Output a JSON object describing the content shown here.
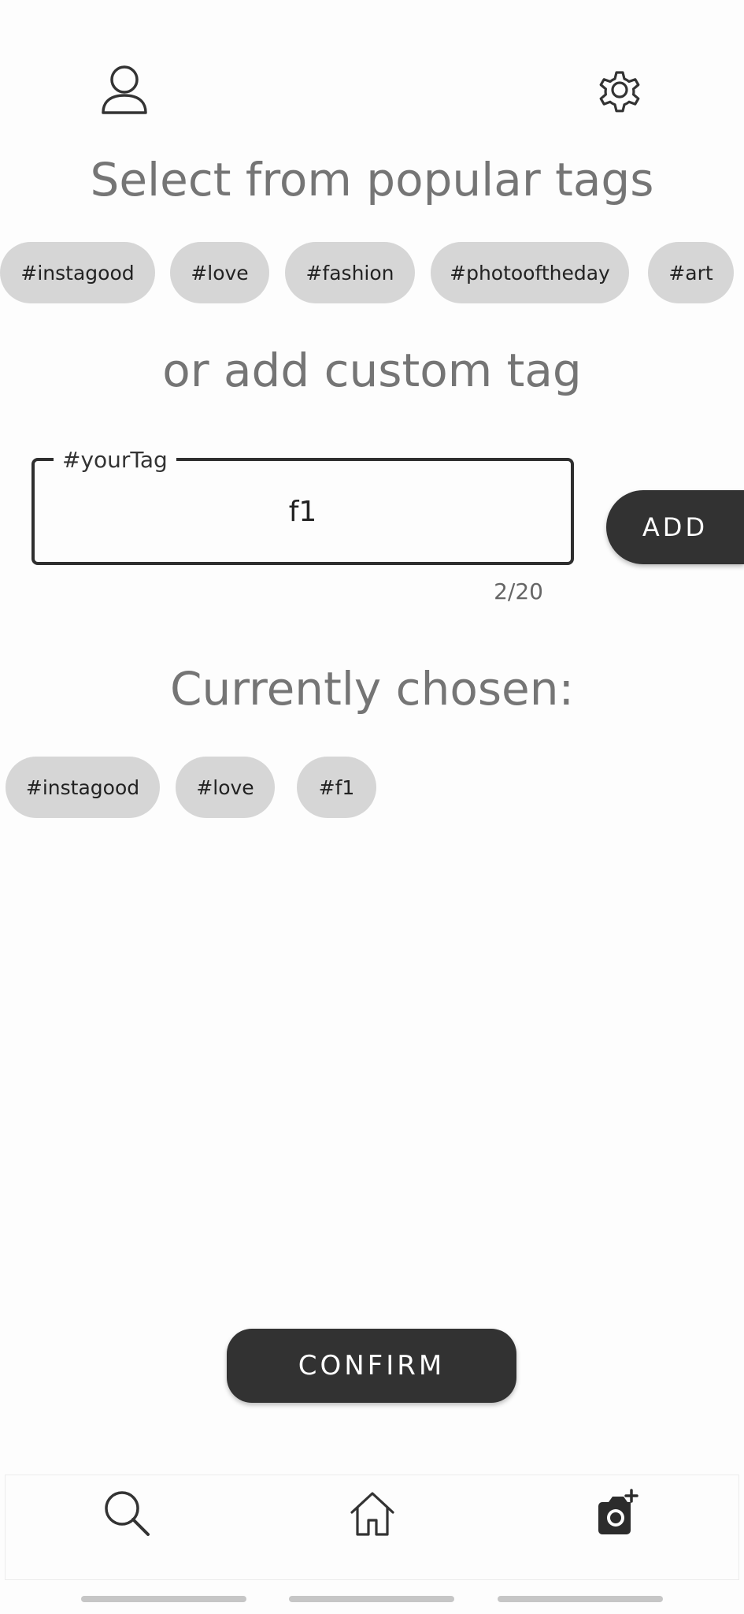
{
  "header": {
    "profile_icon": "person-icon",
    "settings_icon": "gear-icon"
  },
  "popular": {
    "title": "Select from popular tags",
    "tags": [
      "#instagood",
      "#love",
      "#fashion",
      "#photooftheday",
      "#art"
    ]
  },
  "custom": {
    "title": "or add custom tag",
    "field_label": "#yourTag",
    "field_value": "f1",
    "counter": "2/20",
    "add_label": "ADD"
  },
  "chosen": {
    "title": "Currently chosen:",
    "tags": [
      "#instagood",
      "#love",
      "#f1"
    ]
  },
  "confirm_label": "CONFIRM",
  "bottom_nav": {
    "items": [
      "search-icon",
      "home-icon",
      "add-photo-camera-icon"
    ]
  },
  "colors": {
    "chip_background": "#d6d6d6",
    "button_dark": "#323232",
    "heading_gray": "#757575"
  }
}
